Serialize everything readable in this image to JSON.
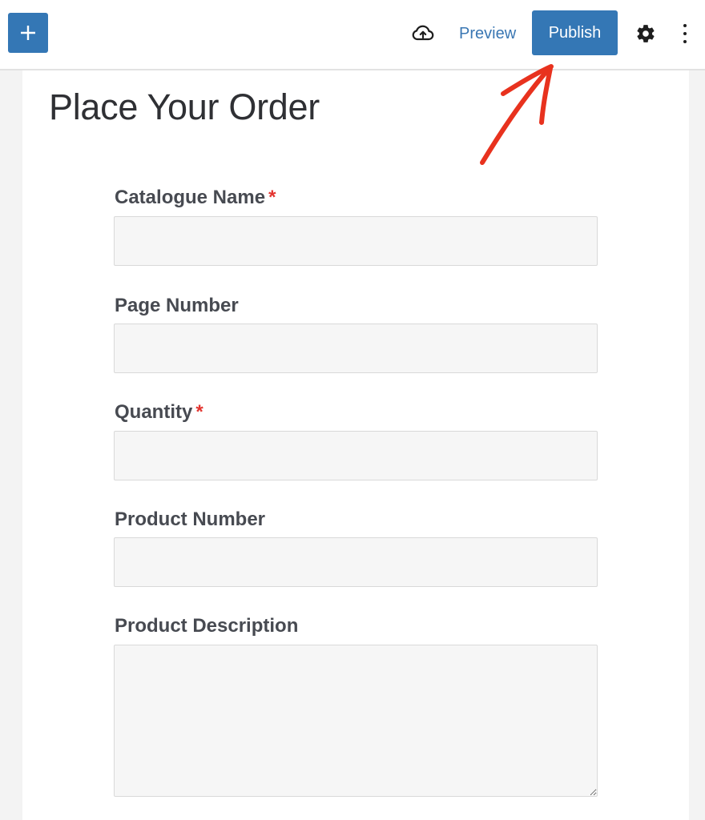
{
  "toolbar": {
    "add_block_icon": "plus-icon",
    "save_icon": "cloud-upload-icon",
    "preview_label": "Preview",
    "publish_label": "Publish",
    "settings_icon": "gear-icon",
    "more_icon": "vertical-ellipsis-icon"
  },
  "colors": {
    "accent": "#3477b5",
    "required": "#e3342f",
    "annotation_arrow": "#e8321e"
  },
  "page": {
    "title": "Place Your Order"
  },
  "form": {
    "fields": [
      {
        "label": "Catalogue Name",
        "required": true,
        "required_mark": "*",
        "type": "text",
        "value": ""
      },
      {
        "label": "Page Number",
        "required": false,
        "type": "text",
        "value": ""
      },
      {
        "label": "Quantity",
        "required": true,
        "required_mark": "*",
        "type": "text",
        "value": ""
      },
      {
        "label": "Product Number",
        "required": false,
        "type": "text",
        "value": ""
      },
      {
        "label": "Product Description",
        "required": false,
        "type": "textarea",
        "value": ""
      }
    ]
  },
  "annotation": {
    "type": "hand-drawn-arrow",
    "points_to": "Publish"
  }
}
